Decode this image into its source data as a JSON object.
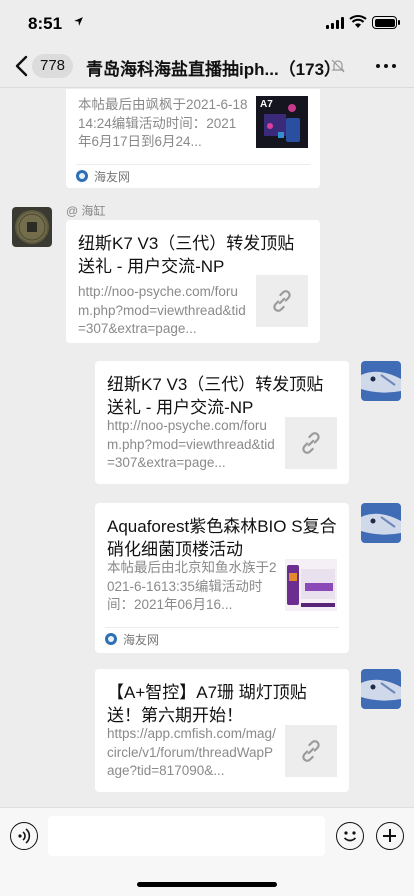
{
  "status_bar": {
    "time": "8:51"
  },
  "header": {
    "unread_count": "778",
    "title": "青岛海科海盐直播抽iph...（173）"
  },
  "messages": [
    {
      "title": "",
      "description": "本帖最后由飒枫于2021-6-1814:24编辑活动时间：2021年6月17日到6月24...",
      "source": "海友网",
      "thumb_text": "A7"
    },
    {
      "sender_name": "@ 海缸",
      "title": "纽斯K7 V3（三代）转发顶贴送礼 - 用户交流-NP",
      "description": "http://noo-psyche.com/forum.php?mod=viewthread&tid=307&extra=page..."
    },
    {
      "title": "纽斯K7 V3（三代）转发顶贴送礼 - 用户交流-NP",
      "description": "http://noo-psyche.com/forum.php?mod=viewthread&tid=307&extra=page..."
    },
    {
      "title": "Aquaforest紫色森林BIO S复合硝化细菌顶楼活动",
      "description": "本帖最后由北京知鱼水族于2021-6-1613:35编辑活动时间：2021年06月16...",
      "source": "海友网"
    },
    {
      "title": "【A+智控】A7珊 瑚灯顶贴送！第六期开始！",
      "description": "https://app.cmfish.com/mag/circle/v1/forum/threadWapPage?tid=817090&..."
    }
  ],
  "input": {
    "placeholder": ""
  }
}
